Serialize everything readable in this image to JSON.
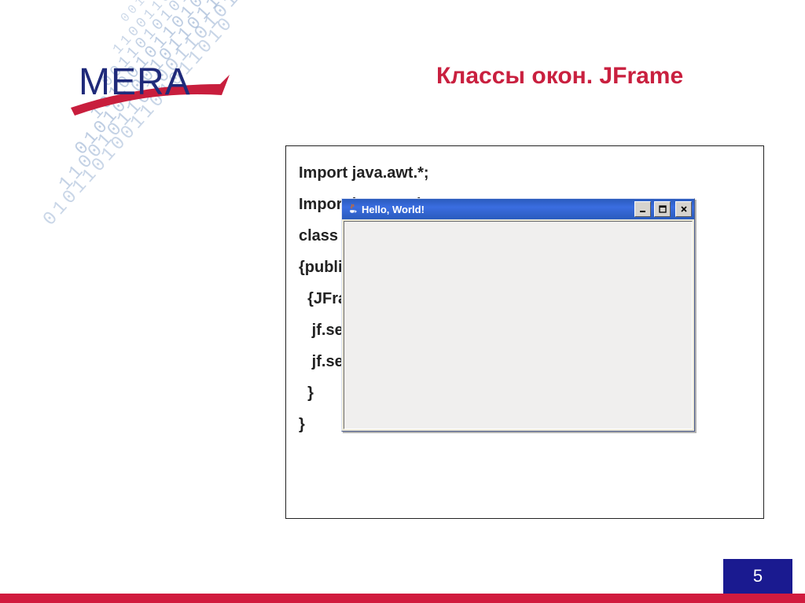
{
  "slide": {
    "title": "Классы окон. JFrame",
    "page_number": "5"
  },
  "logo": {
    "text": "MERA"
  },
  "code": {
    "lines": [
      "Import java.awt.*;",
      "Import javax.swing.*;",
      "class Main",
      "{public static void main(String[] args)",
      "  {JFrame jf=new JFrame(\"Hello, World!\");",
      "   jf.setSize(400,200);",
      "   jf.setVisible(true);",
      "  }",
      "}"
    ]
  },
  "java_window": {
    "title": "Hello, World!"
  },
  "binary_rows": [
    "1010100110100101101",
    "0010110100110101010",
    "1100110101010010110",
    "0011010101101010010",
    "1010010110100101010",
    "0101010010110110100",
    "1100101101001101010",
    "0101101001101011010"
  ]
}
